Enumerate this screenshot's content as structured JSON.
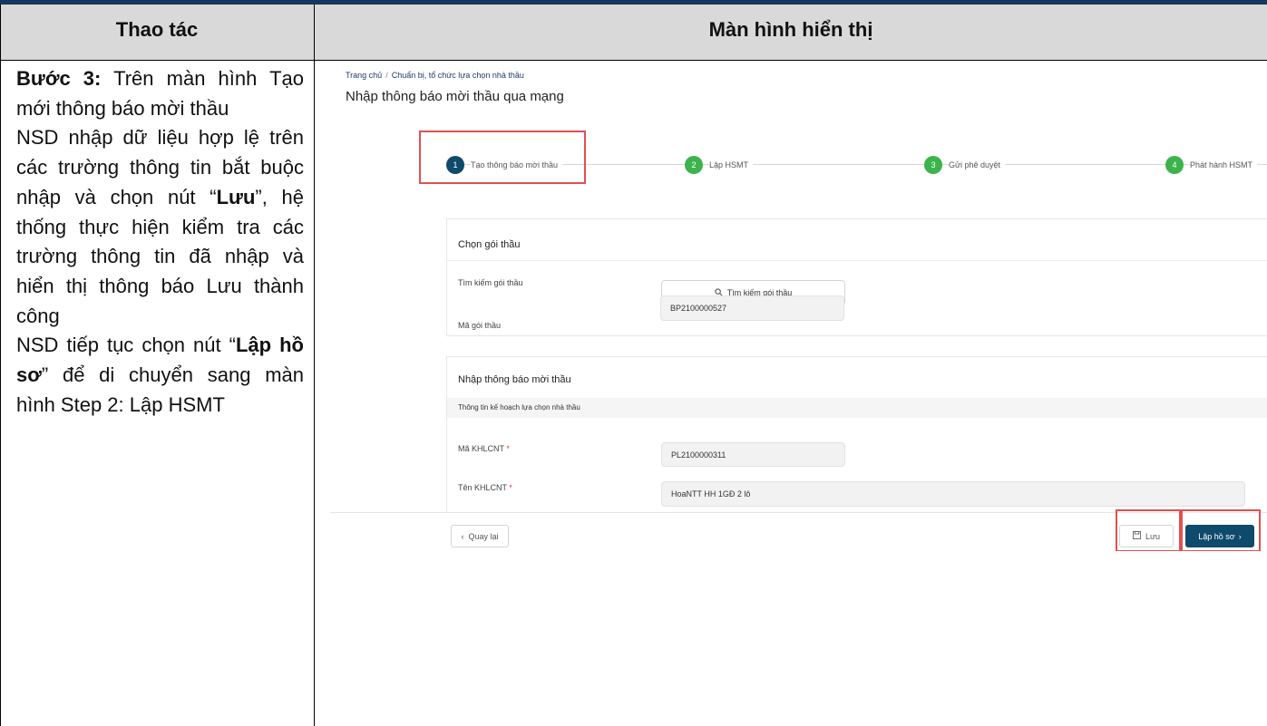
{
  "table": {
    "header_left": "Thao tác",
    "header_right": "Màn hình hiển thị"
  },
  "instructions": {
    "step_label": "Bước 3:",
    "step_text_1": " Trên màn hình Tạo mới thông báo mời thầu",
    "p2_before": "NSD nhập dữ liệu hợp lệ trên các trường thông tin bắt buộc nhập và chọn nút “",
    "p2_bold": "Lưu",
    "p2_after": "”, hệ thống thực hiện kiểm tra các trường thông tin đã nhập và hiển thị thông báo Lưu thành công",
    "p3_before": "NSD tiếp tục chọn nút “",
    "p3_bold": "Lập hồ sơ",
    "p3_after": "” để di chuyển sang màn hình Step 2: Lập HSMT"
  },
  "screen": {
    "breadcrumb_home": "Trang chủ",
    "breadcrumb_sep": "/",
    "breadcrumb_current": "Chuẩn bị, tổ chức lựa chọn nhà thầu",
    "page_title": "Nhập thông báo mời thầu qua mạng",
    "steps": [
      {
        "num": "1",
        "label": "Tạo thông báo mời thầu"
      },
      {
        "num": "2",
        "label": "Lập HSMT"
      },
      {
        "num": "3",
        "label": "Gửi phê duyệt"
      },
      {
        "num": "4",
        "label": "Phát hành HSMT"
      }
    ],
    "package_card": {
      "title": "Chọn gói thầu",
      "search_label": "Tìm kiếm gói thầu",
      "search_button": "Tìm kiếm gói thầu",
      "code_label": "Mã gói thầu",
      "code_value": "BP2100000527"
    },
    "notice_card": {
      "title": "Nhập thông báo mời thầu",
      "section": "Thông tin kế hoạch lựa chọn nhà thầu",
      "khlcnt_code_label": "Mã KHLCNT",
      "khlcnt_code_value": "PL2100000311",
      "khlcnt_name_label": "Tên KHLCNT",
      "khlcnt_name_value": "HoaNTT HH 1GĐ 2 lô",
      "required_mark": "*"
    },
    "footer": {
      "back": "Quay lại",
      "save": "Lưu",
      "create": "Lập hồ sơ"
    }
  },
  "colors": {
    "accent": "#0e4a6b",
    "step_done": "#3cb44b",
    "highlight": "#e05050",
    "header_bg": "#d9d9d9",
    "top_bar": "#17365d"
  },
  "icons": [
    "search-icon",
    "chevron-left-icon",
    "save-icon",
    "chevron-right-icon"
  ]
}
